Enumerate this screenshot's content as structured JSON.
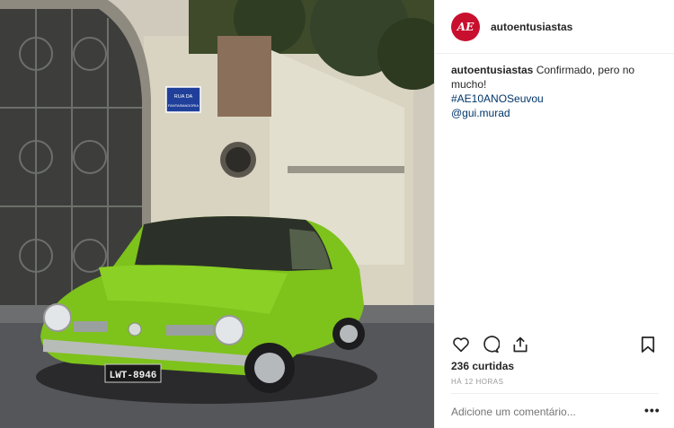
{
  "post": {
    "username": "autoentusiastas",
    "avatar_text": "AE",
    "avatar_color": "#c8102e",
    "photo": {
      "street_sign": [
        "RUA DA",
        "FANTASMAGORIA"
      ],
      "license_plate": "LWT-8946"
    }
  },
  "caption": {
    "username": "autoentusiastas",
    "text": "Confirmado, pero no mucho!",
    "hashtag": "#AE10ANOSeuvou",
    "mention": "@gui.murad"
  },
  "actions": {
    "like_icon": "heart-icon",
    "comment_icon": "speech-bubble-icon",
    "share_icon": "share-icon",
    "save_icon": "bookmark-icon"
  },
  "likes": {
    "text": "236 curtidas"
  },
  "timestamp": {
    "text": "HÁ 12 HORAS"
  },
  "comment_box": {
    "placeholder": "Adicione um comentário...",
    "more": "•••"
  },
  "colors": {
    "link": "#003569",
    "muted": "#999999",
    "car": "#7ec21c"
  }
}
